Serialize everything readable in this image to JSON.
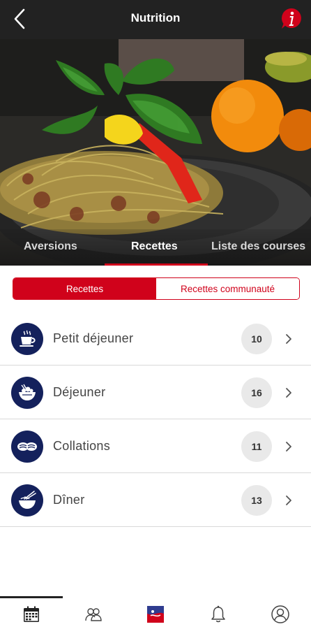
{
  "header": {
    "title": "Nutrition",
    "back_icon": "chevron-left-icon",
    "info_icon": "info-icon",
    "info_color": "#d0021b"
  },
  "tabs": [
    {
      "label": "Aversions",
      "active": false
    },
    {
      "label": "Recettes",
      "active": true
    },
    {
      "label": "Liste des courses",
      "active": false
    }
  ],
  "segment": {
    "left": "Recettes",
    "right": "Recettes communauté",
    "selected": "Recettes"
  },
  "categories": [
    {
      "label": "Petit déjeuner",
      "count": "10",
      "icon": "coffee-cup-icon"
    },
    {
      "label": "Déjeuner",
      "count": "16",
      "icon": "lunch-bowl-icon"
    },
    {
      "label": "Collations",
      "count": "11",
      "icon": "snack-cookies-icon"
    },
    {
      "label": "Dîner",
      "count": "13",
      "icon": "noodle-bowl-icon"
    }
  ],
  "bottom_nav": [
    {
      "name": "calendar-icon",
      "active": true
    },
    {
      "name": "community-icon",
      "active": false
    },
    {
      "name": "app-logo-icon",
      "active": false
    },
    {
      "name": "bell-icon",
      "active": false
    },
    {
      "name": "profile-icon",
      "active": false
    }
  ],
  "colors": {
    "accent": "#d0021b",
    "navy": "#14215c",
    "topbar": "#222222"
  }
}
